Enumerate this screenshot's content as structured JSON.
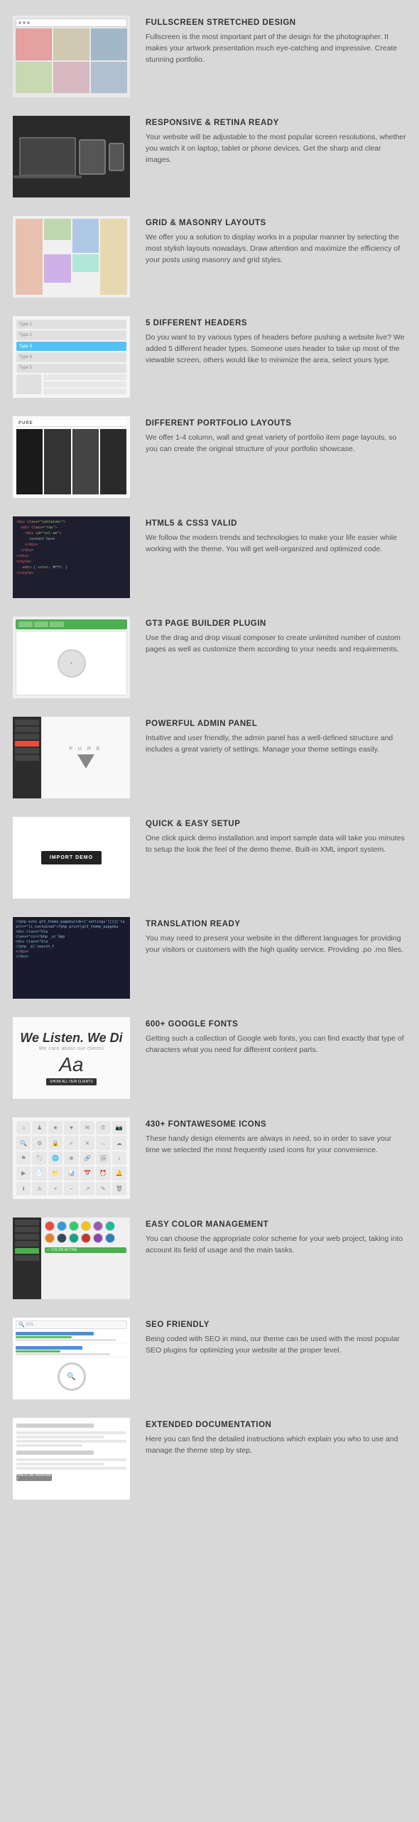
{
  "features": [
    {
      "id": "fullscreen",
      "title": "FULLSCREEN STRETCHED DESIGN",
      "desc": "Fullscreen is the most important part of the design for the photographer. It makes your artwork presentation much eye-catching and impressive. Create stunning portfolio."
    },
    {
      "id": "responsive",
      "title": "RESPONSIVE & RETINA READY",
      "desc": "Your website will be adjustable to the most popular screen resolutions, whether you watch it on laptop, tablet or phone devices. Get the sharp and clear images."
    },
    {
      "id": "grid",
      "title": "GRID & MASONRY LAYOUTS",
      "desc": "We offer you a solution to display works in a popular manner by selecting the most stylish layouts nowadays. Draw attention and maximize the efficiency of your posts using masonry and grid styles."
    },
    {
      "id": "headers",
      "title": "5 DIFFERENT HEADERS",
      "desc": "Do you want to try various types of headers before pushing a website live? We added 5 different header types. Someone uses header to take up most of the viewable screen, others would like to minimize the area, select yours type."
    },
    {
      "id": "portfolio",
      "title": "DIFFERENT PORTFOLIO LAYOUTS",
      "desc": "We offer 1-4 column, wall and great variety of portfolio item page layouts, so you can create the original structure of your portfolio showcase."
    },
    {
      "id": "html5",
      "title": "HTML5 & CSS3 VALID",
      "desc": "We follow the modern trends and technologies to make your life easier while working with the theme. You will get well-organized and optimized code."
    },
    {
      "id": "gt3",
      "title": "GT3 PAGE BUILDER PLUGIN",
      "desc": "Use the drag and drop visual composer to create unlimited number of custom pages as well as customize them according to your needs and requirements."
    },
    {
      "id": "admin",
      "title": "POWERFUL ADMIN PANEL",
      "desc": "Intuitive and user friendly, the admin panel has a well-defined structure and includes a great variety of settings. Manage your theme settings easily."
    },
    {
      "id": "setup",
      "title": "QUICK & EASY SETUP",
      "desc": "One click quick demo installation and import sample data will take you minutes to setup the look the feel of the demo theme. Built-in XML import system."
    },
    {
      "id": "translation",
      "title": "TRANSLATION READY",
      "desc": "You may need to present your website in the different languages for providing your visitors or customers with the high quality service. Providing .po .mo files."
    },
    {
      "id": "fonts",
      "title": "600+ GOOGLE FONTS",
      "desc": "Getting such a collection of Google web fonts, you can find exactly that type of characters what you need for different content parts."
    },
    {
      "id": "fontawesome",
      "title": "430+ FONTAWESOME ICONS",
      "desc": "These handy design elements are always in need, so in order to save your time we selected the most frequently used icons for your convenience."
    },
    {
      "id": "color",
      "title": "EASY COLOR MANAGEMENT",
      "desc": "You can choose the appropriate color scheme for your web project, taking into account its field of usage and the main tasks."
    },
    {
      "id": "seo",
      "title": "SEO FRIENDLY",
      "desc": "Being coded with SEO in mind, our theme can be used with the most popular SEO plugins for optimizing your website at the proper level."
    },
    {
      "id": "docs",
      "title": "EXTENDED DOCUMENTATION",
      "desc": "Here you can find the detailed instructions which explain you who to use and manage the theme step by step."
    }
  ],
  "import_button_label": "IMPORT DEMO",
  "font_listen": "We Listen. We Di",
  "font_care": "We care about our clients",
  "font_a": "Aa",
  "admin_logo": "P U R E",
  "how_to": "How to use shortcode ?"
}
